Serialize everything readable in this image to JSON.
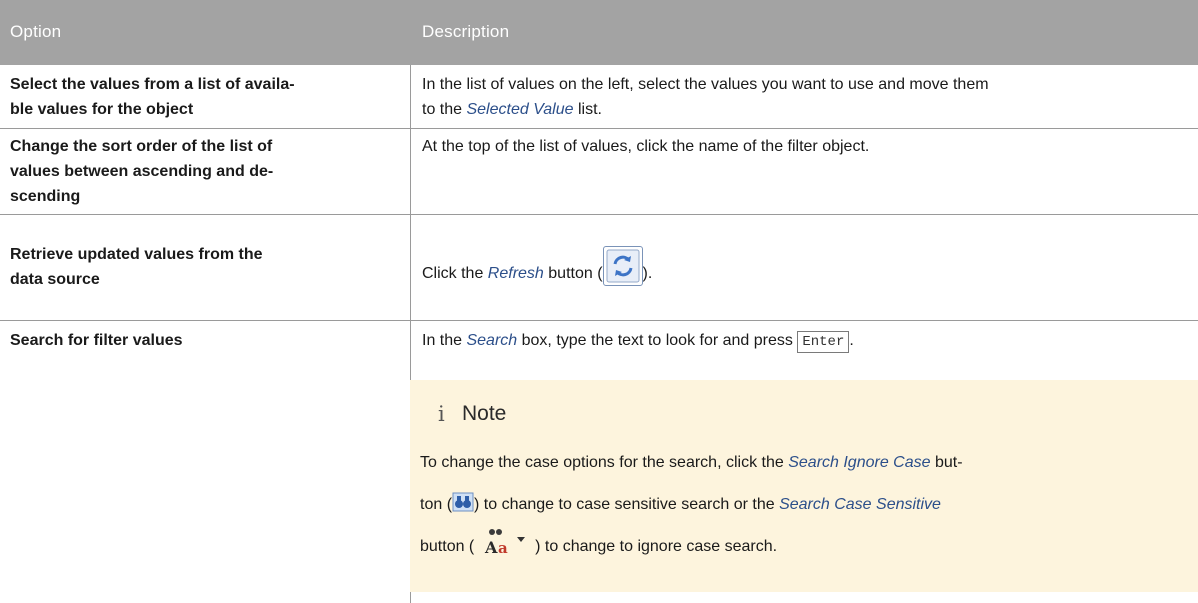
{
  "table": {
    "headers": {
      "option": "Option",
      "description": "Description"
    },
    "rows": [
      {
        "option": [
          "Select the values from a list of availa-",
          "ble values for the object"
        ],
        "description": {
          "line1": "In the list of values on the left, select the values you want to use and move them",
          "pre": "to the ",
          "link": "Selected Value",
          "post": " list."
        }
      },
      {
        "option": [
          "Change the sort order of the list of",
          "values between ascending and de-",
          "scending"
        ],
        "description": {
          "text": "At the top of the list of values, click the name of the filter object."
        }
      },
      {
        "option": [
          "Retrieve updated values from the",
          "data source"
        ],
        "description": {
          "pre": "Click the ",
          "link": "Refresh",
          "mid": " button (",
          "post": ")."
        }
      },
      {
        "option": [
          "Search for filter values"
        ],
        "description": {
          "pre": "In the ",
          "link": "Search",
          "mid": " box, type the text to look for and press ",
          "key": "Enter",
          "post": "."
        }
      }
    ]
  },
  "note": {
    "icon": "i",
    "title": "Note",
    "line1_pre": "To change the case options for the search, click the ",
    "line1_link": "Search Ignore Case",
    "line1_post": " but-",
    "line2_pre": "ton (",
    "line2_mid": ") to change to case sensitive search or the ",
    "line2_link": "Search Case Sensitive",
    "line3_pre": "button ( ",
    "line3_post": " ) to change to ignore case search."
  },
  "colors": {
    "header_bg": "#a3a3a3",
    "note_bg": "#fdf4dd",
    "link": "#2c4f8a"
  },
  "icons": [
    "refresh-icon",
    "binoculars-icon",
    "binoculars-aa-dropdown-icon"
  ]
}
